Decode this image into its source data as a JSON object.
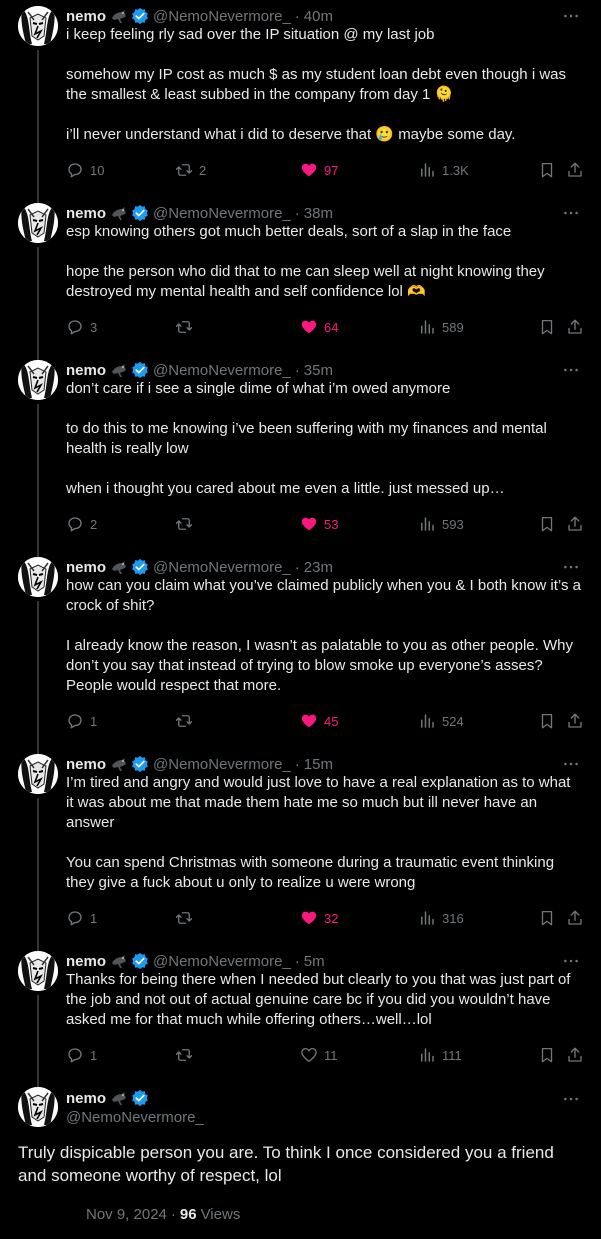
{
  "author": {
    "name": "nemo",
    "handle": "@NemoNevermore_"
  },
  "colors": {
    "background": "#000000",
    "text": "#e7e9ea",
    "muted": "#71767b",
    "like_active": "#f91880",
    "verified": "#1d9bf0"
  },
  "tweets": [
    {
      "time": "40m",
      "paragraphs": [
        "i keep feeling rly sad over the IP situation @ my last job",
        "somehow my IP cost as much $ as my student loan debt even though i was the smallest & least subbed in the company from day 1 🫠",
        "i’ll never understand what i did to deserve that 🥲 maybe some day."
      ],
      "replies": "10",
      "retweets": "2",
      "likes": "97",
      "liked": true,
      "views": "1.3K"
    },
    {
      "time": "38m",
      "paragraphs": [
        "esp knowing others got much better deals, sort of a slap in the face",
        "hope the person who did that to me can sleep well at night knowing they destroyed my mental health and self confidence lol 🫶"
      ],
      "replies": "3",
      "retweets": "",
      "likes": "64",
      "liked": true,
      "views": "589"
    },
    {
      "time": "35m",
      "paragraphs": [
        "don’t care if i see a single dime of what i’m owed anymore",
        "to do this to me knowing i’ve been suffering with my finances and mental health is really low",
        "when i thought you cared about me even a little. just messed up…"
      ],
      "replies": "2",
      "retweets": "",
      "likes": "53",
      "liked": true,
      "views": "593"
    },
    {
      "time": "23m",
      "paragraphs": [
        "how can you claim what you’ve claimed publicly when you & I both know it’s a crock of shit?",
        "I already know the reason, I wasn’t as palatable to you as other people. Why don’t you say that instead of trying to blow smoke up everyone’s asses? People would respect that more."
      ],
      "replies": "1",
      "retweets": "",
      "likes": "45",
      "liked": true,
      "views": "524"
    },
    {
      "time": "15m",
      "paragraphs": [
        "I’m tired and angry and would just love to have a real explanation as to what it was about me that made them hate me so much but ill never have an answer",
        "You can spend Christmas with someone during a traumatic event thinking they give a fuck about u only to realize u were wrong"
      ],
      "replies": "1",
      "retweets": "",
      "likes": "32",
      "liked": true,
      "views": "316"
    },
    {
      "time": "5m",
      "paragraphs": [
        "Thanks for being there when I needed but clearly to you that was just part of the job and not out of actual genuine care bc if you did you wouldn’t have asked me for that much while offering others…well…lol"
      ],
      "replies": "1",
      "retweets": "",
      "likes": "11",
      "liked": false,
      "views": "111"
    }
  ],
  "main": {
    "text": "Truly dispicable person you are. To think I once considered you a friend and someone worthy of respect, lol",
    "date": "Nov 9, 2024",
    "views_count": "96",
    "views_label": "Views"
  }
}
